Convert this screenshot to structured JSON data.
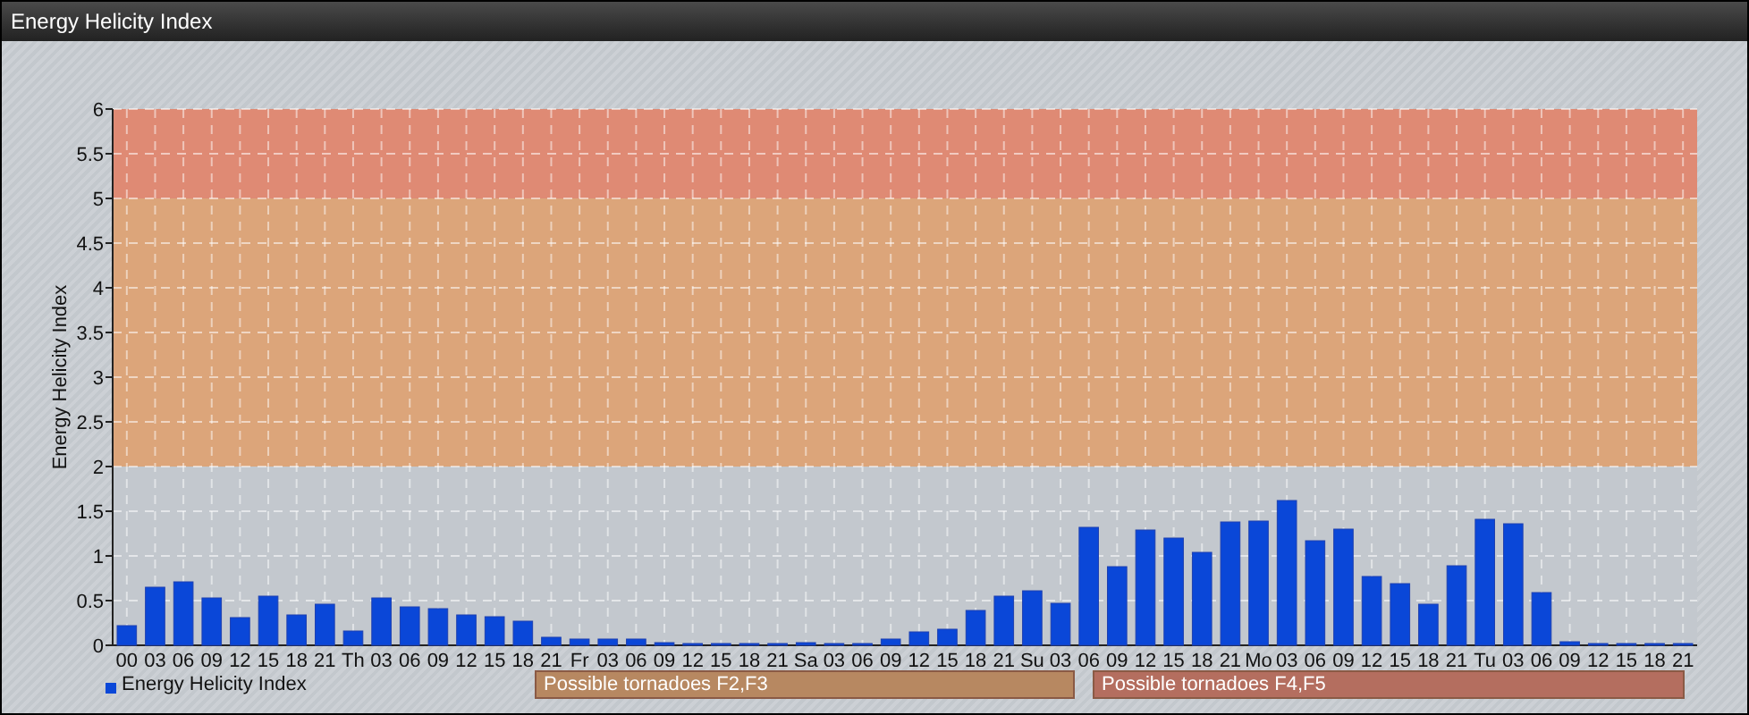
{
  "window": {
    "title": "Energy Helicity Index"
  },
  "chart": {
    "chart_data": {
      "type": "bar",
      "ylabel": "Energy Helicity Index",
      "categories": [
        "00",
        "03",
        "06",
        "09",
        "12",
        "15",
        "18",
        "21",
        "Th",
        "03",
        "06",
        "09",
        "12",
        "15",
        "18",
        "21",
        "Fr",
        "03",
        "06",
        "09",
        "12",
        "15",
        "18",
        "21",
        "Sa",
        "03",
        "06",
        "09",
        "12",
        "15",
        "18",
        "21",
        "Su",
        "03",
        "06",
        "09",
        "12",
        "15",
        "18",
        "21",
        "Mo",
        "03",
        "06",
        "09",
        "12",
        "15",
        "18",
        "21",
        "Tu",
        "03",
        "06",
        "09",
        "12",
        "15",
        "18",
        "21"
      ],
      "series": [
        {
          "name": "Energy Helicity Index",
          "color": "#0a47d8",
          "values": [
            0.22,
            0.65,
            0.71,
            0.53,
            0.31,
            0.55,
            0.34,
            0.46,
            0.16,
            0.53,
            0.43,
            0.41,
            0.34,
            0.32,
            0.27,
            0.09,
            0.07,
            0.07,
            0.07,
            0.03,
            0.02,
            0.02,
            0.02,
            0.02,
            0.03,
            0.02,
            0.02,
            0.07,
            0.15,
            0.18,
            0.39,
            0.55,
            0.61,
            0.47,
            1.32,
            0.88,
            1.29,
            1.2,
            1.04,
            1.38,
            1.39,
            1.62,
            1.17,
            1.3,
            0.77,
            0.69,
            0.46,
            0.89,
            1.41,
            1.36,
            0.59,
            0.04,
            0.02,
            0.02,
            0.02,
            0.02
          ]
        }
      ],
      "ylim": [
        0,
        6
      ],
      "yticks": [
        0,
        0.5,
        1,
        1.5,
        2,
        2.5,
        3,
        3.5,
        4,
        4.5,
        5,
        5.5,
        6
      ],
      "grid": true,
      "bands": [
        {
          "axis": "y",
          "from": 0,
          "to": 2,
          "color": "#c3c8ce"
        },
        {
          "axis": "y",
          "from": 2,
          "to": 5,
          "color": "#dca57a"
        },
        {
          "axis": "y",
          "from": 5,
          "to": 6,
          "color": "#df8a74"
        }
      ]
    }
  },
  "warnings": [
    {
      "label": "Possible tornadoes F2,F3",
      "color": "#b78861"
    },
    {
      "label": "Possible tornadoes F4,F5",
      "color": "#b46e5f"
    }
  ]
}
